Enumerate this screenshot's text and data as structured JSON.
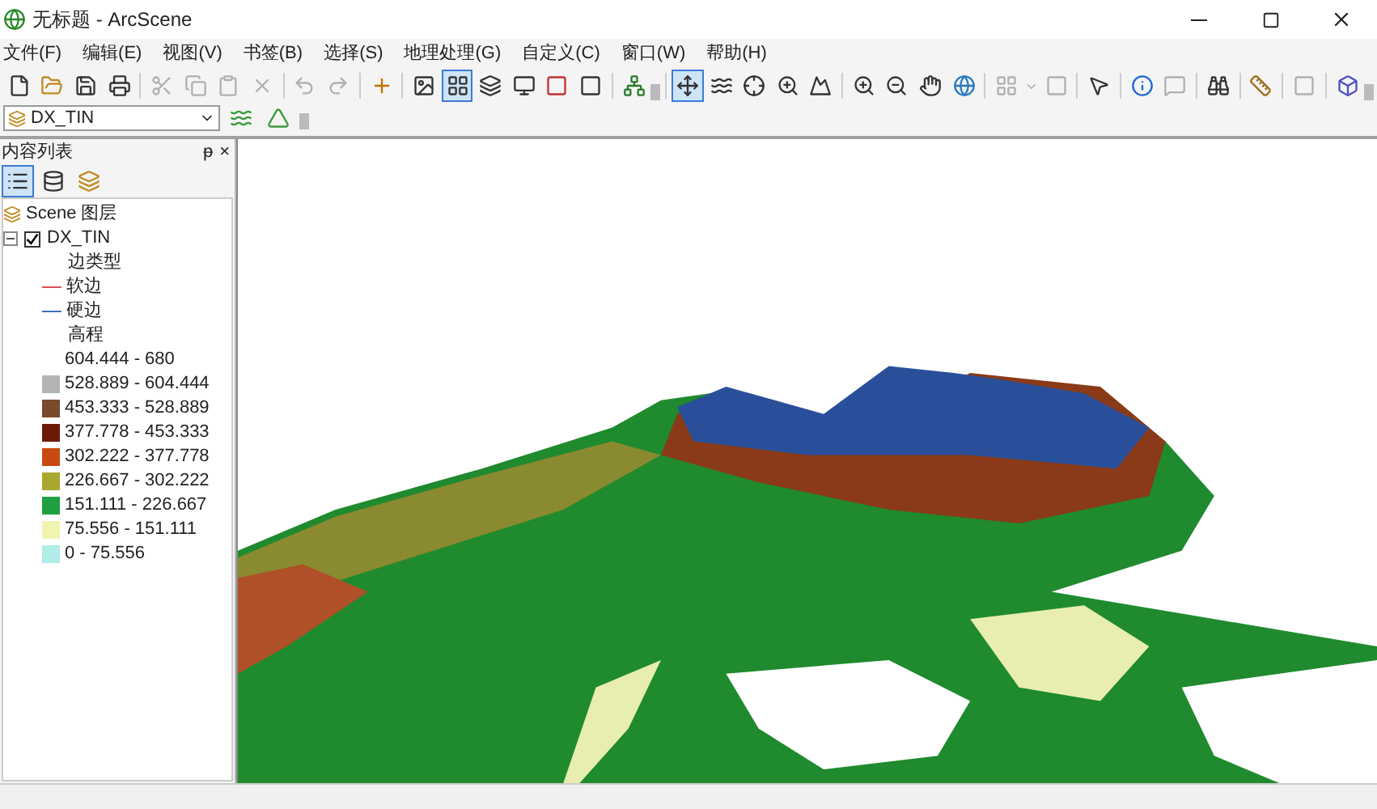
{
  "window": {
    "title": "无标题 - ArcScene"
  },
  "menu": [
    "文件(F)",
    "编辑(E)",
    "视图(V)",
    "书签(B)",
    "选择(S)",
    "地理处理(G)",
    "自定义(C)",
    "窗口(W)",
    "帮助(H)"
  ],
  "layer_select": {
    "value": "DX_TIN"
  },
  "toc": {
    "title": "内容列表",
    "pin": "ᵽ",
    "close": "×",
    "root": {
      "label": "Scene 图层",
      "layer": {
        "label": "DX_TIN",
        "checked": true,
        "expanded": true,
        "legend": [
          {
            "kind": "heading",
            "label": "边类型"
          },
          {
            "kind": "line",
            "label": "软边",
            "color": "#e05050"
          },
          {
            "kind": "line",
            "label": "硬边",
            "color": "#4070c0"
          },
          {
            "kind": "heading",
            "label": "高程"
          },
          {
            "kind": "blank",
            "label": "604.444 - 680"
          },
          {
            "kind": "swatch",
            "label": "528.889 - 604.444",
            "color": "#b4b4b4"
          },
          {
            "kind": "swatch",
            "label": "453.333 - 528.889",
            "color": "#7a4a2a"
          },
          {
            "kind": "swatch",
            "label": "377.778 - 453.333",
            "color": "#6e1a08"
          },
          {
            "kind": "swatch",
            "label": "302.222 - 377.778",
            "color": "#c84a10"
          },
          {
            "kind": "swatch",
            "label": "226.667 - 302.222",
            "color": "#a8a830"
          },
          {
            "kind": "swatch",
            "label": "151.111 - 226.667",
            "color": "#20a040"
          },
          {
            "kind": "swatch",
            "label": "75.556 - 151.111",
            "color": "#f0f4b0"
          },
          {
            "kind": "swatch",
            "label": "0 - 75.556",
            "color": "#b0ece8"
          }
        ]
      }
    }
  }
}
